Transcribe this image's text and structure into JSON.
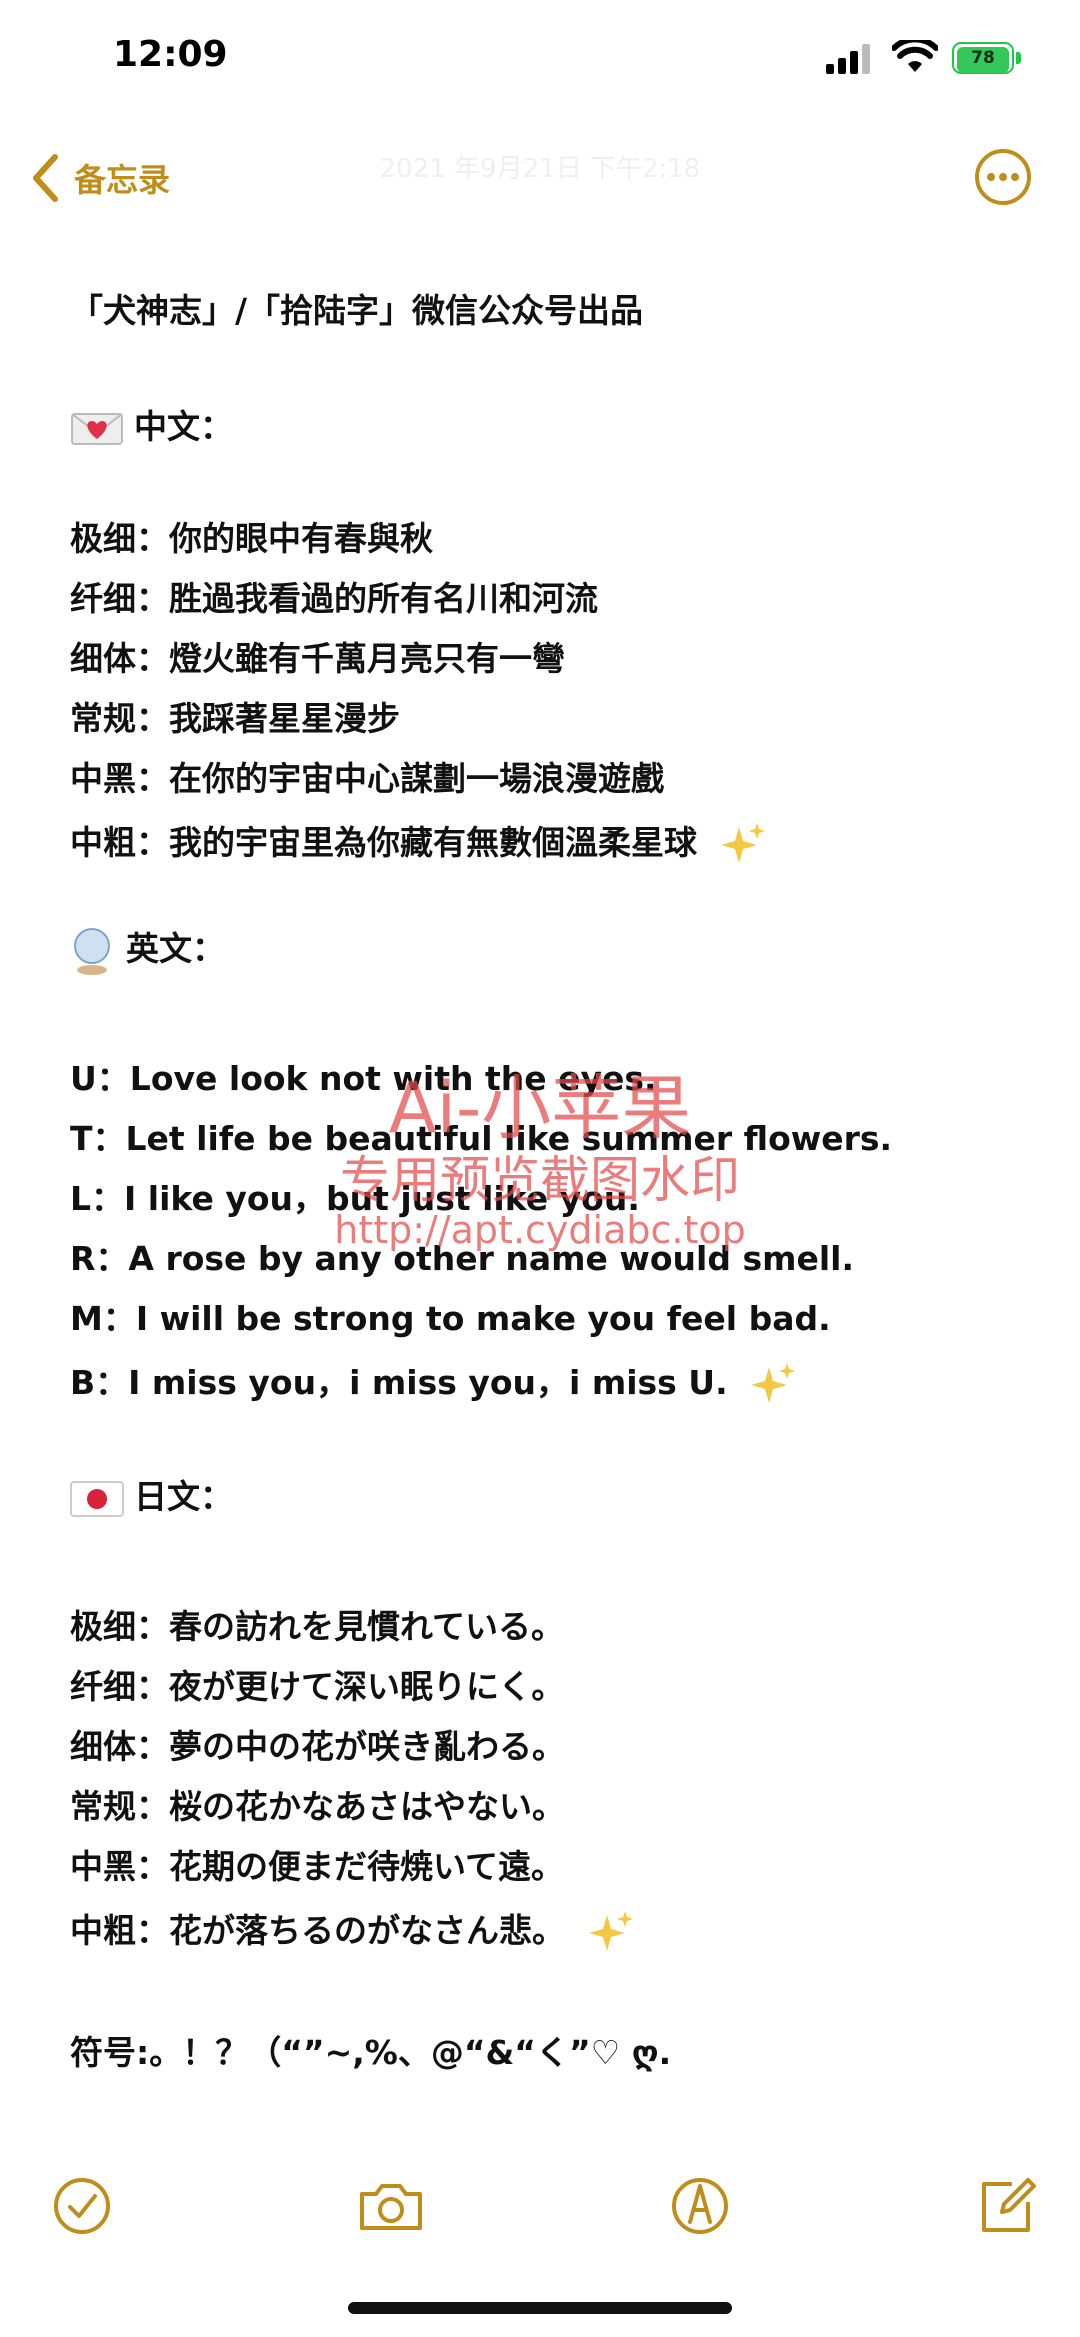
{
  "status_bar": {
    "time": "12:09",
    "battery": "78"
  },
  "nav": {
    "back_label": "备忘录",
    "subtitle": "2021 年9月21日 下午2:18",
    "more_icon": "ellipsis-circle-icon"
  },
  "note": {
    "header": "「犬神志」/「拾陆字」微信公众号出品",
    "sections": {
      "zh": {
        "title": "中文：",
        "lines": [
          "极细：你的眼中有春與秋",
          "纤细：胜過我看過的所有名川和河流",
          "细体：燈火雖有千萬月亮只有一彎",
          "常规：我踩著星星漫步",
          "中黑：在你的宇宙中心謀劃一場浪漫遊戲",
          "中粗：我的宇宙里為你藏有無數個溫柔星球"
        ]
      },
      "en": {
        "title": "英文：",
        "lines": [
          "U：Love look not with the eyes.",
          "T：Let life be beautiful like summer flowers.",
          "L：I like you，but just like you.",
          "R：A rose by any other name would smell.",
          "M：I will be strong to make you feel bad.",
          "B：I miss you，i miss you，i miss U."
        ]
      },
      "jp": {
        "title": "日文：",
        "lines": [
          "极细：春の訪れを見慣れている。",
          "纤细：夜が更けて深い眠りにく。",
          "细体：夢の中の花が咲き亂わる。",
          "常规：桜の花かなあさはやない。",
          "中黑：花期の便まだ待焼いて遠。",
          "中粗：花が落ちるのがなさん悲。"
        ]
      }
    },
    "symbols": "符号:。！？（“”~,%、@“&“く”♡ ღ."
  },
  "watermark": {
    "line1": "Ai-小苹果",
    "line2": "专用预览截图水印",
    "line3": "http://apt.cydiabc.top"
  },
  "colors": {
    "accent": "#c08d1a",
    "text": "#111111",
    "watermark": "#e24a4a",
    "battery": "#34c759"
  },
  "toolbar": {
    "icons": [
      "checklist-icon",
      "camera-icon",
      "markup-pen-icon",
      "compose-icon"
    ]
  }
}
